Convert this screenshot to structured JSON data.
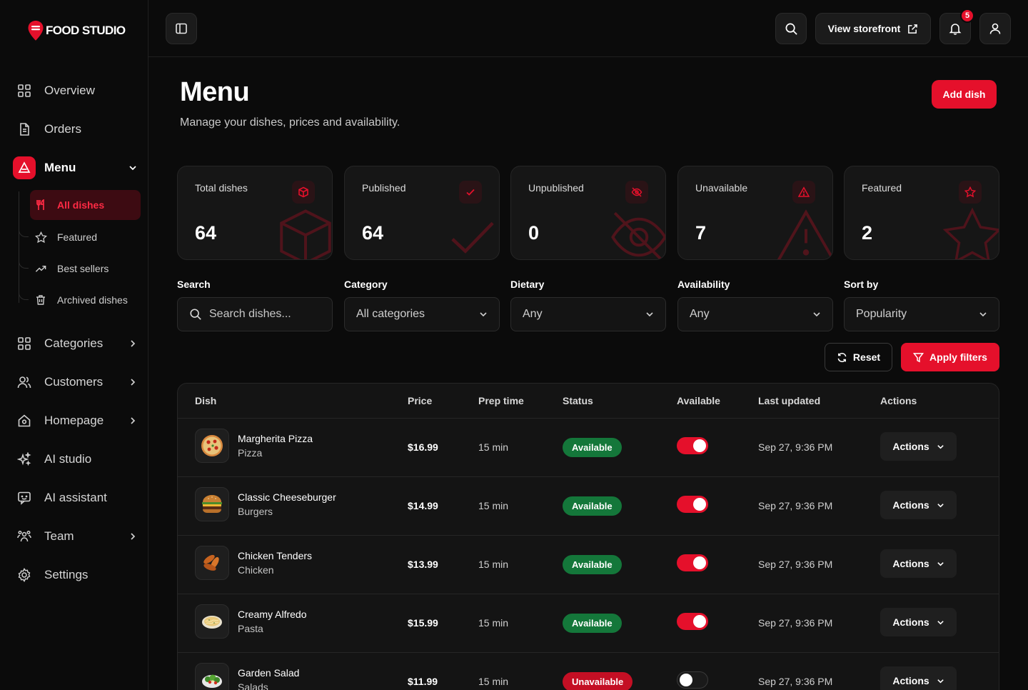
{
  "brand": {
    "name": "FOOD STUDIO",
    "accent": "#e5102b"
  },
  "sidebar": {
    "items": [
      {
        "label": "Overview",
        "icon": "grid-icon"
      },
      {
        "label": "Orders",
        "icon": "document-icon"
      },
      {
        "label": "Menu",
        "icon": "menu-icon"
      },
      {
        "label": "Categories",
        "icon": "grid-icon"
      },
      {
        "label": "Customers",
        "icon": "users-icon"
      },
      {
        "label": "Homepage",
        "icon": "home-icon"
      },
      {
        "label": "AI studio",
        "icon": "sparkles-icon"
      },
      {
        "label": "AI assistant",
        "icon": "chat-bot-icon"
      },
      {
        "label": "Team",
        "icon": "team-icon"
      },
      {
        "label": "Settings",
        "icon": "gear-icon"
      }
    ],
    "submenu": [
      {
        "label": "All dishes",
        "icon": "utensils-icon"
      },
      {
        "label": "Featured",
        "icon": "star-icon"
      },
      {
        "label": "Best sellers",
        "icon": "trending-icon"
      },
      {
        "label": "Archived dishes",
        "icon": "trash-icon"
      }
    ]
  },
  "topbar": {
    "storefront_label": "View storefront",
    "notification_count": "5"
  },
  "header": {
    "title": "Menu",
    "subtitle": "Manage your dishes, prices and availability.",
    "add_label": "Add dish"
  },
  "stats": [
    {
      "label": "Total dishes",
      "value": "64",
      "icon": "box-icon"
    },
    {
      "label": "Published",
      "value": "64",
      "icon": "check-icon"
    },
    {
      "label": "Unpublished",
      "value": "0",
      "icon": "eye-off-icon"
    },
    {
      "label": "Unavailable",
      "value": "7",
      "icon": "warning-icon"
    },
    {
      "label": "Featured",
      "value": "2",
      "icon": "star-icon"
    }
  ],
  "filters": {
    "search": {
      "label": "Search",
      "placeholder": "Search dishes..."
    },
    "category": {
      "label": "Category",
      "value": "All categories"
    },
    "dietary": {
      "label": "Dietary",
      "value": "Any"
    },
    "availability": {
      "label": "Availability",
      "value": "Any"
    },
    "sort": {
      "label": "Sort by",
      "value": "Popularity"
    },
    "reset_label": "Reset",
    "apply_label": "Apply filters"
  },
  "table": {
    "headers": [
      "Dish",
      "Price",
      "Prep time",
      "Status",
      "Available",
      "Last updated",
      "Actions"
    ],
    "rows": [
      {
        "name": "Margherita Pizza",
        "category": "Pizza",
        "price": "$16.99",
        "prep": "15 min",
        "status": "Available",
        "available": true,
        "updated": "Sep 27, 9:36 PM",
        "action": "Actions"
      },
      {
        "name": "Classic Cheeseburger",
        "category": "Burgers",
        "price": "$14.99",
        "prep": "15 min",
        "status": "Available",
        "available": true,
        "updated": "Sep 27, 9:36 PM",
        "action": "Actions"
      },
      {
        "name": "Chicken Tenders",
        "category": "Chicken",
        "price": "$13.99",
        "prep": "15 min",
        "status": "Available",
        "available": true,
        "updated": "Sep 27, 9:36 PM",
        "action": "Actions"
      },
      {
        "name": "Creamy Alfredo",
        "category": "Pasta",
        "price": "$15.99",
        "prep": "15 min",
        "status": "Available",
        "available": true,
        "updated": "Sep 27, 9:36 PM",
        "action": "Actions"
      },
      {
        "name": "Garden Salad",
        "category": "Salads",
        "price": "$11.99",
        "prep": "15 min",
        "status": "Unavailable",
        "available": false,
        "updated": "Sep 27, 9:36 PM",
        "action": "Actions"
      }
    ]
  }
}
